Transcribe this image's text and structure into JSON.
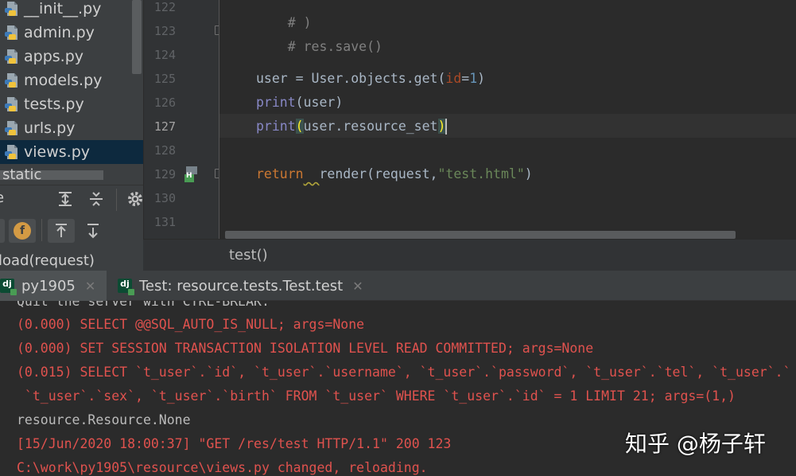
{
  "project_tree": {
    "files": [
      "__init__.py",
      "admin.py",
      "apps.py",
      "models.py",
      "tests.py",
      "urls.py",
      "views.py"
    ],
    "selected": "views.py",
    "partial_folder": "static"
  },
  "structure_panel": {
    "title_fragment": "e",
    "field_badge": "f",
    "method_item": "load(request)"
  },
  "editor": {
    "line_numbers": [
      "122",
      "123",
      "124",
      "125",
      "126",
      "127",
      "128",
      "129",
      "130",
      "131"
    ],
    "current_line": "127",
    "lines": {
      "l122": "# )",
      "l123": "# res.save()",
      "l125_a": "user = User.objects.get(",
      "l125_param": "id",
      "l125_eq": "=",
      "l125_num": "1",
      "l125_close": ")",
      "l126_print": "print",
      "l126_rest": "(user)",
      "l127_print": "print",
      "l127_open": "(",
      "l127_mid": "user.resource_set",
      "l127_close": ")",
      "l129_return": "return",
      "l129_sp": "  ",
      "l129_call": "render(request,",
      "l129_str": "\"test.html\"",
      "l129_close": ")"
    },
    "gutter_badge": "H",
    "breadcrumb": "test()"
  },
  "run_tabs": [
    {
      "label": "py1905",
      "active": true,
      "icon": "django-icon"
    },
    {
      "label": "Test: resource.tests.Test.test",
      "active": false,
      "icon": "django-icon"
    }
  ],
  "console": {
    "lines": [
      {
        "text": "Quit the server with CTRL-BREAK.",
        "color": "#bbbbbb"
      },
      {
        "text": "(0.000) SELECT @@SQL_AUTO_IS_NULL; args=None",
        "color": "#e0524e"
      },
      {
        "text": "(0.000) SET SESSION TRANSACTION ISOLATION LEVEL READ COMMITTED; args=None",
        "color": "#e0524e"
      },
      {
        "text": "(0.015) SELECT `t_user`.`id`, `t_user`.`username`, `t_user`.`password`, `t_user`.`tel`, `t_user`.`",
        "color": "#e0524e"
      },
      {
        "text": " `t_user`.`sex`, `t_user`.`birth` FROM `t_user` WHERE `t_user`.`id` = 1 LIMIT 21; args=(1,)",
        "color": "#e0524e"
      },
      {
        "text": "resource.Resource.None",
        "color": "#bbbbbb"
      },
      {
        "text": "[15/Jun/2020 18:00:37] \"GET /res/test HTTP/1.1\" 200 123",
        "color": "#e0524e"
      },
      {
        "text": "C:\\work\\py1905\\resource\\views.py changed, reloading.",
        "color": "#e0524e"
      }
    ]
  },
  "watermark": "知乎 @杨子轩",
  "colors": {
    "background": "#2b2b2b",
    "panel": "#3c3f41",
    "keyword": "#cc7832",
    "string": "#6a8759",
    "error_text": "#e0524e"
  }
}
